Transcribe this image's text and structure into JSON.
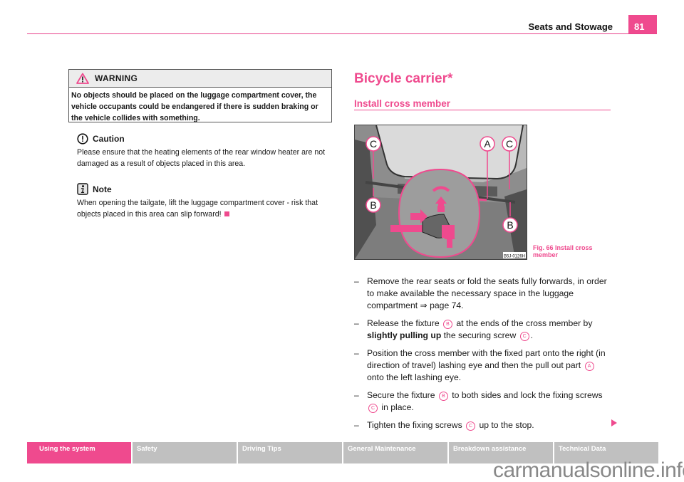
{
  "header": {
    "title": "Seats and Stowage",
    "page_number": "81"
  },
  "warning": {
    "icon": "warning-triangle-icon",
    "title": "WARNING",
    "text": "No objects should be placed on the luggage compartment cover, the vehicle occupants could be endangered if there is sudden braking or the vehicle collides with something."
  },
  "caution": {
    "icon": "caution-exclamation-icon",
    "title": "Caution",
    "text": "Please ensure that the heating elements of the rear window heater are not damaged as a result of objects placed in this area."
  },
  "note": {
    "icon": "info-note-icon",
    "title": "Note",
    "text": "When opening the tailgate, lift the luggage compartment cover - risk that objects placed in this area can slip forward!"
  },
  "section": {
    "title": "Bicycle carrier*",
    "subtitle": "Install cross member"
  },
  "figure": {
    "labels": {
      "A": "A",
      "B": "B",
      "C": "C"
    },
    "code": "B5J-0126H",
    "caption": "Fig. 66   Install cross member"
  },
  "steps": [
    {
      "dash": "–",
      "parts": [
        "Remove the rear seats or fold the seats fully forwards, in order to make available the necessary space in the luggage compartment ",
        "⇒",
        " page 74."
      ]
    },
    {
      "dash": "–",
      "a": "Release the fixture ",
      "b": "B",
      "c": " at the ends of the cross member by ",
      "bold": "slightly pulling up",
      "d": " the securing screw ",
      "e": "C",
      "f": "."
    },
    {
      "dash": "–",
      "a": "Position the cross member with the fixed part onto the right (in direction of travel) lashing eye and then the pull out part ",
      "b": "A",
      "c": " onto the left lashing eye."
    },
    {
      "dash": "–",
      "a": "Secure the fixture ",
      "b": "B",
      "c": " to both sides and lock the fixing screws ",
      "d": "C",
      "e": " in place."
    },
    {
      "dash": "–",
      "a": "Tighten the fixing screws ",
      "b": "C",
      "c": " up to the stop."
    }
  ],
  "footer_tabs": [
    {
      "label": "Using the system",
      "active": true
    },
    {
      "label": "Safety",
      "active": false
    },
    {
      "label": "Driving Tips",
      "active": false
    },
    {
      "label": "General Maintenance",
      "active": false
    },
    {
      "label": "Breakdown assistance",
      "active": false
    },
    {
      "label": "Technical Data",
      "active": false
    }
  ],
  "watermark": "carmanualsonline.info",
  "colors": {
    "accent": "#ef4a8e",
    "tab_inactive": "#c0c0c0"
  }
}
